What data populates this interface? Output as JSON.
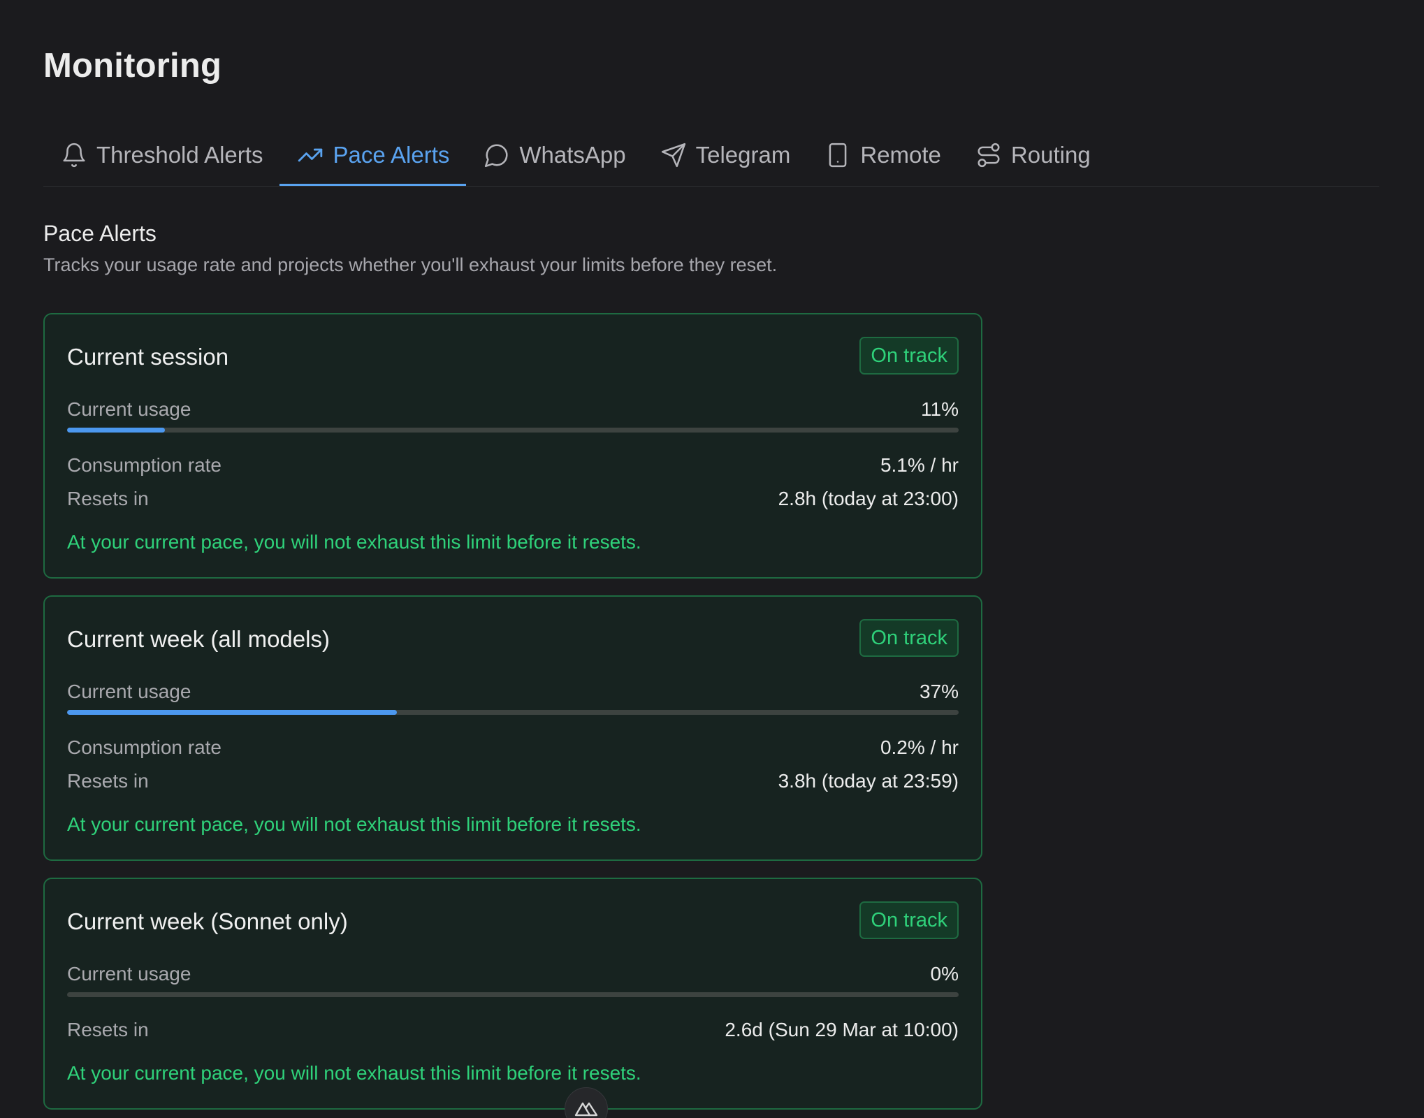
{
  "page": {
    "title": "Monitoring"
  },
  "tabs": [
    {
      "label": "Threshold Alerts",
      "icon": "bell-icon",
      "active": false
    },
    {
      "label": "Pace Alerts",
      "icon": "trending-up-icon",
      "active": true
    },
    {
      "label": "WhatsApp",
      "icon": "chat-bubble-icon",
      "active": false
    },
    {
      "label": "Telegram",
      "icon": "send-icon",
      "active": false
    },
    {
      "label": "Remote",
      "icon": "phone-icon",
      "active": false
    },
    {
      "label": "Routing",
      "icon": "route-icon",
      "active": false
    }
  ],
  "section": {
    "title": "Pace Alerts",
    "description": "Tracks your usage rate and projects whether you'll exhaust your limits before they reset."
  },
  "cards": [
    {
      "title": "Current session",
      "status": "On track",
      "usage_label": "Current usage",
      "usage_value": "11%",
      "usage_fraction": 0.11,
      "rate_label": "Consumption rate",
      "rate_value": "5.1% / hr",
      "resets_label": "Resets in",
      "resets_value": "2.8h (today at 23:00)",
      "message": "At your current pace, you will not exhaust this limit before it resets."
    },
    {
      "title": "Current week (all models)",
      "status": "On track",
      "usage_label": "Current usage",
      "usage_value": "37%",
      "usage_fraction": 0.37,
      "rate_label": "Consumption rate",
      "rate_value": "0.2% / hr",
      "resets_label": "Resets in",
      "resets_value": "3.8h (today at 23:59)",
      "message": "At your current pace, you will not exhaust this limit before it resets."
    },
    {
      "title": "Current week (Sonnet only)",
      "status": "On track",
      "usage_label": "Current usage",
      "usage_value": "0%",
      "usage_fraction": 0.0,
      "resets_label": "Resets in",
      "resets_value": "2.6d (Sun 29 Mar at 10:00)",
      "message": "At your current pace, you will not exhaust this limit before it resets."
    }
  ],
  "colors": {
    "background": "#1b1b1e",
    "accent": "#5aa3f0",
    "progress_fill": "#4c98ef",
    "success": "#2fd17a",
    "card_border": "#1e6a41"
  },
  "floating_button": {
    "icon": "nuxt-logo-icon"
  }
}
